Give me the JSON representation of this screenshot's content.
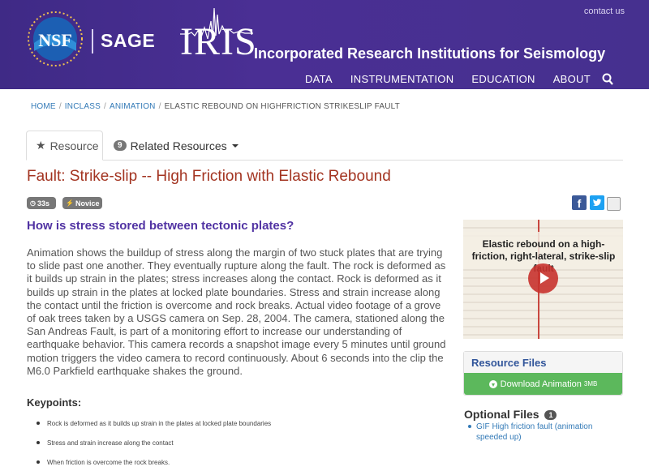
{
  "header": {
    "contact_link": "contact us",
    "nsf_logo_text": "NSF",
    "sage_label": "SAGE",
    "iris_logo_text": "IRIS",
    "iris_full_name": "Incorporated Research Institutions for Seismology",
    "nav": [
      "DATA",
      "INSTRUMENTATION",
      "EDUCATION",
      "ABOUT"
    ]
  },
  "breadcrumb": [
    "HOME",
    "INCLASS",
    "ANIMATION",
    "ELASTIC REBOUND ON HIGHFRICTION STRIKESLIP FAULT"
  ],
  "tabs": {
    "resource": "Resource",
    "related_count": "9",
    "related": "Related Resources"
  },
  "resource": {
    "title": "Fault: Strike-slip -- High Friction with Elastic Rebound",
    "duration": "33s",
    "level": "Novice",
    "question": "How is stress stored between tectonic plates?",
    "description": "Animation shows the buildup of stress along the margin of two stuck plates that are trying to slide past one another. They eventually rupture along the fault. The rock is deformed as it builds up strain in the plates; stress increases along the contact. Rock is deformed as it builds up strain in the plates at locked plate boundaries. Stress and strain increase along the contact until the friction is overcome and rock breaks. Actual video footage of a grove of oak trees taken by a USGS camera on Sep. 28, 2004. The camera, stationed along the San Andreas Fault, is part of a monitoring effort to increase our understanding of earthquake behavior. This camera records a snapshot image every 5 minutes until ground motion triggers the video camera to record continuously. About 6 seconds into the clip the M6.0 Parkfield earthquake shakes the ground.",
    "keypoints_heading": "Keypoints:",
    "keypoints": [
      "Rock is deformed as it builds up strain in the plates at locked plate boundaries",
      "Stress and strain increase along the contact",
      "When friction is overcome the rock breaks."
    ]
  },
  "social": {
    "facebook_glyph": "f"
  },
  "sidebar": {
    "video_caption": "Elastic rebound on a high-friction, right-lateral, strike-slip fault",
    "files_heading": "Resource Files",
    "download_label": "Download Animation",
    "download_size": "3MB",
    "optional_heading": "Optional Files",
    "optional_count": "1",
    "optional_items": [
      "GIF High friction fault (animation speeded up)"
    ]
  },
  "colors": {
    "header_bg": "#45308f",
    "title": "#a33421",
    "question": "#5133a3",
    "link": "#337ab7",
    "download_btn": "#5cb85c"
  }
}
